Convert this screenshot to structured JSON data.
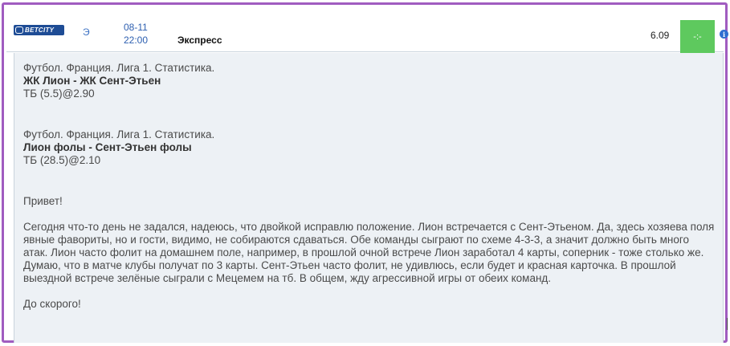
{
  "header": {
    "logo_text": "BETCITY",
    "bet_type_short": "Э",
    "date": "08-11",
    "time": "22:00",
    "bet_kind": "Экспресс",
    "odds": "6.09",
    "result": "-:-",
    "info_icon": "info-icon",
    "colors": {
      "frame": "#a05cc0",
      "result_bg": "#5ec95e",
      "logo_bg": "#1e4c95",
      "accent": "#2d5fb0"
    }
  },
  "picks": [
    {
      "league": "Футбол. Франция. Лига 1. Статистика.",
      "match": "ЖК Лион - ЖК Сент-Этьен",
      "bet": "ТБ (5.5)@2.90"
    },
    {
      "league": "Футбол. Франция. Лига 1. Статистика.",
      "match": "Лион фолы - Сент-Этьен фолы",
      "bet": "ТБ (28.5)@2.10"
    }
  ],
  "message": {
    "greeting": "Привет!",
    "body": "Сегодня что-то день не задался, надеюсь, что двойкой исправлю положение. Лион встречается с Сент-Этьеном. Да, здесь хозяева поля явные фавориты, но и гости, видимо, не собираются сдаваться. Обе команды сыграют по схеме 4-3-3, а значит должно быть много атак. Лион часто фолит на домашнем поле, например, в прошлой очной встрече Лион заработал 4 карты, соперник - тоже столько же. Думаю, что в матче клубы получат по 3 карты. Сент-Этьен часто фолит, не удивлюсь, если будет и красная карточка. В прошлой выездной встрече зелёные сыграли с Мецемем на тб. В общем, жду агрессивной игры от обеих команд.",
    "signoff": "До скорого!"
  }
}
